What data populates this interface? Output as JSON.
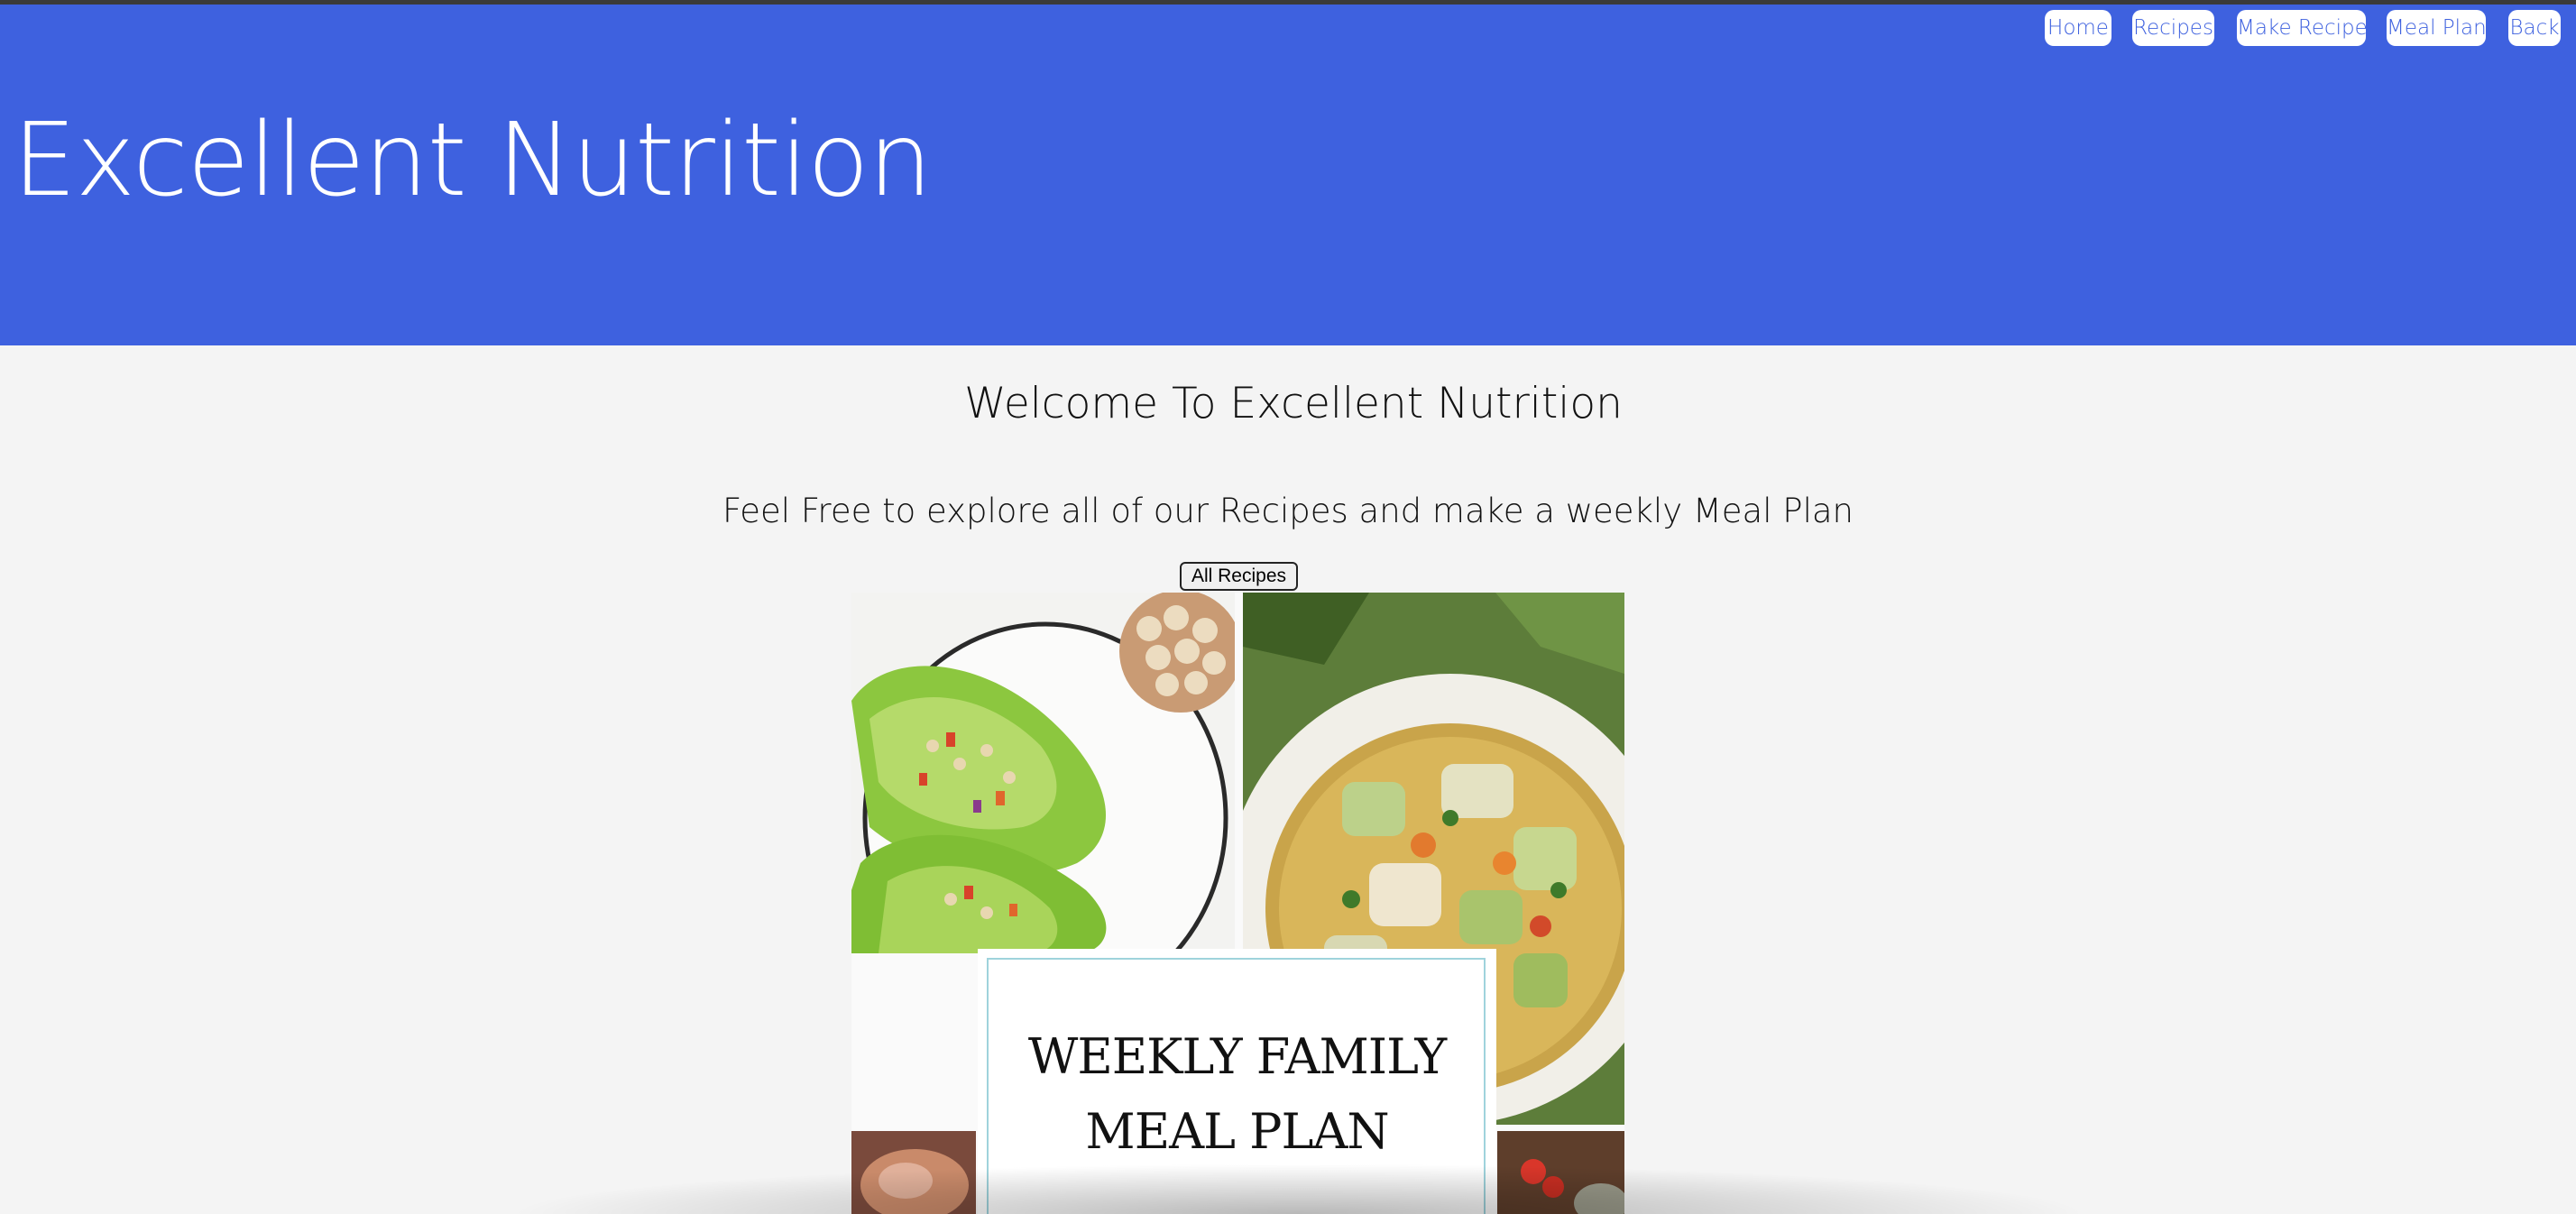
{
  "site": {
    "title": "Excellent Nutrition"
  },
  "nav": {
    "items": [
      {
        "label": "Home"
      },
      {
        "label": "Recipes"
      },
      {
        "label": "Make Recipe"
      },
      {
        "label": "Meal Plan"
      },
      {
        "label": "Back"
      }
    ]
  },
  "main": {
    "welcome": "Welcome To Excellent Nutrition",
    "subtitle": "Feel Free to explore all of our Recipes and make a weekly Meal Plan",
    "all_recipes_button": "All Recipes",
    "banner": {
      "line1": "WEEKLY FAMILY",
      "line2": "MEAL PLAN"
    }
  },
  "colors": {
    "header": "#3e61df",
    "nav_text": "#3e61df",
    "page_background": "#f4f4f4"
  }
}
